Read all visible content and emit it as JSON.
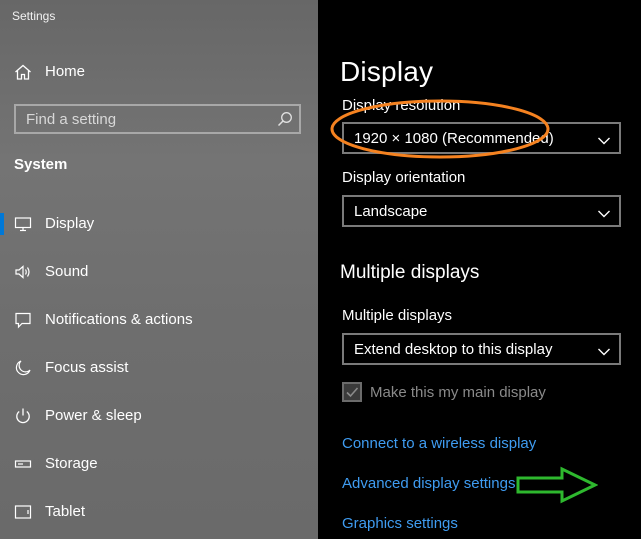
{
  "app": {
    "title": "Settings"
  },
  "sidebar": {
    "home": {
      "label": "Home",
      "icon": "home-icon"
    },
    "search": {
      "placeholder": "Find a setting",
      "icon": "search-icon"
    },
    "section_label": "System",
    "items": [
      {
        "label": "Display",
        "icon": "monitor-icon",
        "selected": true
      },
      {
        "label": "Sound",
        "icon": "speaker-icon",
        "selected": false
      },
      {
        "label": "Notifications & actions",
        "icon": "notification-icon",
        "selected": false
      },
      {
        "label": "Focus assist",
        "icon": "moon-icon",
        "selected": false
      },
      {
        "label": "Power & sleep",
        "icon": "power-icon",
        "selected": false
      },
      {
        "label": "Storage",
        "icon": "storage-icon",
        "selected": false
      },
      {
        "label": "Tablet",
        "icon": "tablet-icon",
        "selected": false
      }
    ]
  },
  "main": {
    "title": "Display",
    "resolution": {
      "label": "Display resolution",
      "value": "1920 × 1080 (Recommended)"
    },
    "orientation": {
      "label": "Display orientation",
      "value": "Landscape"
    },
    "multiple_heading": "Multiple displays",
    "multiple": {
      "label": "Multiple displays",
      "value": "Extend desktop to this display"
    },
    "main_display_checkbox": {
      "label": "Make this my main display",
      "checked": true,
      "disabled": true
    },
    "links": [
      "Connect to a wireless display",
      "Advanced display settings",
      "Graphics settings"
    ]
  },
  "colors": {
    "accent": "#0078d7",
    "link": "#3f9cf1",
    "annotation_ellipse": "#f58220",
    "annotation_arrow": "#2eb82e"
  }
}
